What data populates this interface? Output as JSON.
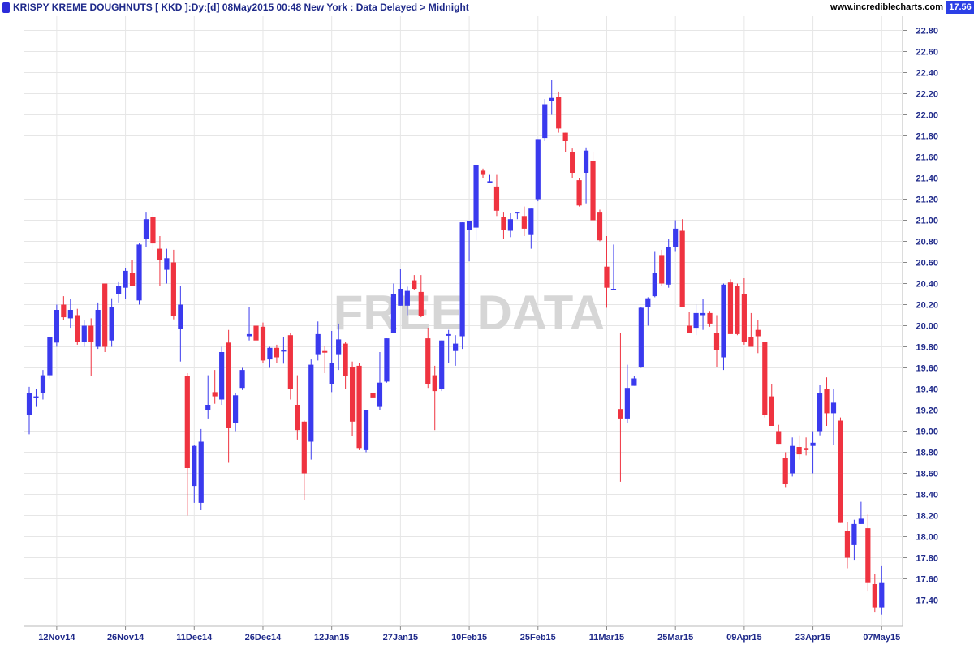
{
  "header": {
    "title": "KRISPY KREME DOUGHNUTS [ KKD ]:Dy:[d]  08May2015 00:48 New York : Data Delayed > Midnight",
    "site": "www.incrediblecharts.com",
    "last_price": "17.56"
  },
  "watermark": "FREE DATA",
  "colors": {
    "up": "#3a3aee",
    "down": "#ef3340",
    "axis_text": "#1f2a8a",
    "grid": "#e6e6e6"
  },
  "chart_data": {
    "type": "candlestick",
    "title": "KRISPY KREME DOUGHNUTS [ KKD ]",
    "ylim": [
      17.2,
      22.9
    ],
    "y_ticks": [
      22.8,
      22.6,
      22.4,
      22.2,
      22.0,
      21.8,
      21.6,
      21.4,
      21.2,
      21.0,
      20.8,
      20.6,
      20.4,
      20.2,
      20.0,
      19.8,
      19.6,
      19.4,
      19.2,
      19.0,
      18.8,
      18.6,
      18.4,
      18.2,
      18.0,
      17.8,
      17.6,
      17.4
    ],
    "x_labels": [
      "12Nov14",
      "26Nov14",
      "11Dec14",
      "26Dec14",
      "12Jan15",
      "27Jan15",
      "10Feb15",
      "25Feb15",
      "11Mar15",
      "25Mar15",
      "09Apr15",
      "23Apr15",
      "07May15"
    ],
    "x_label_bar_index": [
      4,
      14,
      24,
      34,
      44,
      54,
      64,
      74,
      84,
      94,
      104,
      114,
      124
    ],
    "grid": true,
    "candles": [
      {
        "o": 19.15,
        "h": 19.42,
        "l": 18.97,
        "c": 19.36
      },
      {
        "o": 19.33,
        "h": 19.4,
        "l": 19.23,
        "c": 19.33
      },
      {
        "o": 19.36,
        "h": 19.58,
        "l": 19.3,
        "c": 19.53
      },
      {
        "o": 19.53,
        "h": 19.88,
        "l": 19.5,
        "c": 19.89
      },
      {
        "o": 19.84,
        "h": 20.2,
        "l": 19.8,
        "c": 20.15
      },
      {
        "o": 20.2,
        "h": 20.28,
        "l": 20.05,
        "c": 20.08
      },
      {
        "o": 20.07,
        "h": 20.25,
        "l": 19.98,
        "c": 20.15
      },
      {
        "o": 20.1,
        "h": 20.16,
        "l": 19.82,
        "c": 19.85
      },
      {
        "o": 19.85,
        "h": 20.05,
        "l": 19.8,
        "c": 20.0
      },
      {
        "o": 20.0,
        "h": 20.07,
        "l": 19.52,
        "c": 19.85
      },
      {
        "o": 19.8,
        "h": 20.22,
        "l": 19.78,
        "c": 20.15
      },
      {
        "o": 20.4,
        "h": 20.4,
        "l": 19.75,
        "c": 19.8
      },
      {
        "o": 19.86,
        "h": 20.26,
        "l": 19.8,
        "c": 20.18
      },
      {
        "o": 20.3,
        "h": 20.42,
        "l": 20.22,
        "c": 20.38
      },
      {
        "o": 20.36,
        "h": 20.55,
        "l": 20.25,
        "c": 20.52
      },
      {
        "o": 20.5,
        "h": 20.62,
        "l": 20.38,
        "c": 20.38
      },
      {
        "o": 20.24,
        "h": 20.78,
        "l": 20.2,
        "c": 20.77
      },
      {
        "o": 20.82,
        "h": 21.08,
        "l": 20.75,
        "c": 21.01
      },
      {
        "o": 21.03,
        "h": 21.08,
        "l": 20.72,
        "c": 20.78
      },
      {
        "o": 20.73,
        "h": 20.85,
        "l": 20.38,
        "c": 20.62
      },
      {
        "o": 20.53,
        "h": 20.73,
        "l": 20.4,
        "c": 20.64
      },
      {
        "o": 20.6,
        "h": 20.72,
        "l": 20.06,
        "c": 20.09
      },
      {
        "o": 19.97,
        "h": 20.38,
        "l": 19.66,
        "c": 20.2
      },
      {
        "o": 19.52,
        "h": 19.55,
        "l": 18.2,
        "c": 18.65
      },
      {
        "o": 18.48,
        "h": 18.87,
        "l": 18.32,
        "c": 18.86
      },
      {
        "o": 18.32,
        "h": 19.02,
        "l": 18.25,
        "c": 18.9
      },
      {
        "o": 19.2,
        "h": 19.53,
        "l": 19.12,
        "c": 19.25
      },
      {
        "o": 19.37,
        "h": 19.58,
        "l": 19.26,
        "c": 19.33
      },
      {
        "o": 19.3,
        "h": 19.8,
        "l": 19.25,
        "c": 19.75
      },
      {
        "o": 19.84,
        "h": 19.96,
        "l": 18.7,
        "c": 19.03
      },
      {
        "o": 19.08,
        "h": 19.36,
        "l": 19.0,
        "c": 19.34
      },
      {
        "o": 19.41,
        "h": 19.6,
        "l": 19.39,
        "c": 19.58
      },
      {
        "o": 19.9,
        "h": 20.18,
        "l": 19.86,
        "c": 19.92
      },
      {
        "o": 20.0,
        "h": 20.27,
        "l": 19.85,
        "c": 19.86
      },
      {
        "o": 19.99,
        "h": 20.03,
        "l": 19.65,
        "c": 19.67
      },
      {
        "o": 19.68,
        "h": 19.8,
        "l": 19.6,
        "c": 19.79
      },
      {
        "o": 19.79,
        "h": 19.82,
        "l": 19.65,
        "c": 19.7
      },
      {
        "o": 19.77,
        "h": 19.89,
        "l": 19.64,
        "c": 19.77
      },
      {
        "o": 19.91,
        "h": 19.93,
        "l": 19.3,
        "c": 19.4
      },
      {
        "o": 19.25,
        "h": 19.53,
        "l": 18.92,
        "c": 19.01
      },
      {
        "o": 19.09,
        "h": 19.1,
        "l": 18.35,
        "c": 18.6
      },
      {
        "o": 18.9,
        "h": 19.68,
        "l": 18.73,
        "c": 19.63
      },
      {
        "o": 19.73,
        "h": 20.04,
        "l": 19.67,
        "c": 19.92
      },
      {
        "o": 19.76,
        "h": 19.81,
        "l": 19.55,
        "c": 19.75
      },
      {
        "o": 19.45,
        "h": 19.95,
        "l": 19.37,
        "c": 19.65
      },
      {
        "o": 19.73,
        "h": 20.02,
        "l": 19.58,
        "c": 19.87
      },
      {
        "o": 19.83,
        "h": 19.85,
        "l": 19.4,
        "c": 19.52
      },
      {
        "o": 19.61,
        "h": 19.66,
        "l": 18.95,
        "c": 19.09
      },
      {
        "o": 19.62,
        "h": 19.65,
        "l": 18.82,
        "c": 18.84
      },
      {
        "o": 18.82,
        "h": 19.2,
        "l": 18.8,
        "c": 19.2
      },
      {
        "o": 19.36,
        "h": 19.38,
        "l": 19.28,
        "c": 19.32
      },
      {
        "o": 19.23,
        "h": 19.75,
        "l": 19.2,
        "c": 19.46
      },
      {
        "o": 19.47,
        "h": 19.87,
        "l": 19.46,
        "c": 19.88
      },
      {
        "o": 19.93,
        "h": 20.4,
        "l": 19.93,
        "c": 20.3
      },
      {
        "o": 20.19,
        "h": 20.54,
        "l": 20.19,
        "c": 20.35
      },
      {
        "o": 20.19,
        "h": 20.37,
        "l": 20.1,
        "c": 20.33
      },
      {
        "o": 20.43,
        "h": 20.48,
        "l": 20.34,
        "c": 20.35
      },
      {
        "o": 20.32,
        "h": 20.48,
        "l": 20.08,
        "c": 20.09
      },
      {
        "o": 19.88,
        "h": 19.98,
        "l": 19.41,
        "c": 19.45
      },
      {
        "o": 19.53,
        "h": 19.62,
        "l": 19.01,
        "c": 19.38
      },
      {
        "o": 19.4,
        "h": 19.75,
        "l": 19.38,
        "c": 19.86
      },
      {
        "o": 19.92,
        "h": 19.96,
        "l": 19.65,
        "c": 19.92
      },
      {
        "o": 19.76,
        "h": 19.91,
        "l": 19.62,
        "c": 19.83
      },
      {
        "o": 19.9,
        "h": 20.3,
        "l": 19.78,
        "c": 20.98
      },
      {
        "o": 20.91,
        "h": 20.98,
        "l": 20.61,
        "c": 20.99
      },
      {
        "o": 20.93,
        "h": 21.51,
        "l": 20.81,
        "c": 21.52
      },
      {
        "o": 21.47,
        "h": 21.49,
        "l": 21.4,
        "c": 21.43
      },
      {
        "o": 21.36,
        "h": 21.43,
        "l": 21.35,
        "c": 21.37
      },
      {
        "o": 21.32,
        "h": 21.43,
        "l": 21.04,
        "c": 21.09
      },
      {
        "o": 21.03,
        "h": 21.08,
        "l": 20.82,
        "c": 20.91
      },
      {
        "o": 20.9,
        "h": 21.07,
        "l": 20.84,
        "c": 21.01
      },
      {
        "o": 21.07,
        "h": 21.08,
        "l": 21.01,
        "c": 21.08
      },
      {
        "o": 21.04,
        "h": 21.13,
        "l": 20.85,
        "c": 20.92
      },
      {
        "o": 20.86,
        "h": 21.11,
        "l": 20.73,
        "c": 21.11
      },
      {
        "o": 21.2,
        "h": 21.77,
        "l": 21.18,
        "c": 21.77
      },
      {
        "o": 21.78,
        "h": 22.15,
        "l": 21.75,
        "c": 22.1
      },
      {
        "o": 22.13,
        "h": 22.33,
        "l": 22.0,
        "c": 22.16
      },
      {
        "o": 22.17,
        "h": 22.22,
        "l": 21.83,
        "c": 21.87
      },
      {
        "o": 21.83,
        "h": 21.78,
        "l": 21.65,
        "c": 21.75
      },
      {
        "o": 21.65,
        "h": 21.68,
        "l": 21.4,
        "c": 21.45
      },
      {
        "o": 21.38,
        "h": 21.4,
        "l": 21.13,
        "c": 21.14
      },
      {
        "o": 21.45,
        "h": 21.69,
        "l": 21.16,
        "c": 21.66
      },
      {
        "o": 21.56,
        "h": 21.65,
        "l": 20.99,
        "c": 21.0
      },
      {
        "o": 21.08,
        "h": 21.1,
        "l": 20.8,
        "c": 20.81
      },
      {
        "o": 20.56,
        "h": 20.85,
        "l": 20.17,
        "c": 20.36
      },
      {
        "o": 20.35,
        "h": 20.77,
        "l": 20.34,
        "c": 20.35
      },
      {
        "o": 19.21,
        "h": 19.93,
        "l": 18.52,
        "c": 19.12
      },
      {
        "o": 19.12,
        "h": 19.63,
        "l": 19.08,
        "c": 19.41
      },
      {
        "o": 19.43,
        "h": 19.52,
        "l": 19.47,
        "c": 19.5
      },
      {
        "o": 19.61,
        "h": 20.18,
        "l": 19.6,
        "c": 20.17
      },
      {
        "o": 20.18,
        "h": 20.27,
        "l": 20.0,
        "c": 20.26
      },
      {
        "o": 20.28,
        "h": 20.7,
        "l": 20.27,
        "c": 20.5
      },
      {
        "o": 20.67,
        "h": 20.72,
        "l": 20.38,
        "c": 20.4
      },
      {
        "o": 20.39,
        "h": 20.82,
        "l": 20.36,
        "c": 20.75
      },
      {
        "o": 20.75,
        "h": 21.0,
        "l": 20.7,
        "c": 20.92
      },
      {
        "o": 20.9,
        "h": 21.01,
        "l": 20.18,
        "c": 20.18
      },
      {
        "o": 20.0,
        "h": 20.13,
        "l": 19.93,
        "c": 19.93
      },
      {
        "o": 19.98,
        "h": 20.2,
        "l": 19.91,
        "c": 20.12
      },
      {
        "o": 20.1,
        "h": 20.25,
        "l": 19.96,
        "c": 20.12
      },
      {
        "o": 20.12,
        "h": 20.14,
        "l": 19.99,
        "c": 20.02
      },
      {
        "o": 19.93,
        "h": 20.1,
        "l": 19.61,
        "c": 19.77
      },
      {
        "o": 19.7,
        "h": 20.4,
        "l": 19.58,
        "c": 20.39
      },
      {
        "o": 20.41,
        "h": 20.44,
        "l": 19.93,
        "c": 19.92
      },
      {
        "o": 20.38,
        "h": 20.4,
        "l": 19.91,
        "c": 19.92
      },
      {
        "o": 20.3,
        "h": 20.45,
        "l": 19.82,
        "c": 19.85
      },
      {
        "o": 19.89,
        "h": 20.12,
        "l": 19.81,
        "c": 19.8
      },
      {
        "o": 19.96,
        "h": 20.05,
        "l": 19.74,
        "c": 19.9
      },
      {
        "o": 19.85,
        "h": 19.84,
        "l": 19.13,
        "c": 19.15
      },
      {
        "o": 19.33,
        "h": 19.45,
        "l": 19.05,
        "c": 19.05
      },
      {
        "o": 19.0,
        "h": 19.06,
        "l": 18.88,
        "c": 18.88
      },
      {
        "o": 18.75,
        "h": 18.8,
        "l": 18.47,
        "c": 18.5
      },
      {
        "o": 18.6,
        "h": 18.94,
        "l": 18.57,
        "c": 18.86
      },
      {
        "o": 18.85,
        "h": 18.96,
        "l": 18.73,
        "c": 18.78
      },
      {
        "o": 18.84,
        "h": 18.94,
        "l": 18.77,
        "c": 18.82
      },
      {
        "o": 18.86,
        "h": 19.0,
        "l": 18.6,
        "c": 18.89
      },
      {
        "o": 19.0,
        "h": 19.44,
        "l": 18.96,
        "c": 19.36
      },
      {
        "o": 19.4,
        "h": 19.51,
        "l": 19.05,
        "c": 19.17
      },
      {
        "o": 19.17,
        "h": 19.4,
        "l": 18.87,
        "c": 19.27
      },
      {
        "o": 19.1,
        "h": 19.13,
        "l": 18.3,
        "c": 18.13
      },
      {
        "o": 18.05,
        "h": 18.14,
        "l": 17.7,
        "c": 17.8
      },
      {
        "o": 17.92,
        "h": 18.16,
        "l": 17.78,
        "c": 18.12
      },
      {
        "o": 18.12,
        "h": 18.33,
        "l": 18.13,
        "c": 18.17
      },
      {
        "o": 18.08,
        "h": 18.21,
        "l": 17.48,
        "c": 17.56
      },
      {
        "o": 17.55,
        "h": 17.65,
        "l": 17.28,
        "c": 17.33
      },
      {
        "o": 17.33,
        "h": 17.72,
        "l": 17.26,
        "c": 17.56
      }
    ]
  }
}
